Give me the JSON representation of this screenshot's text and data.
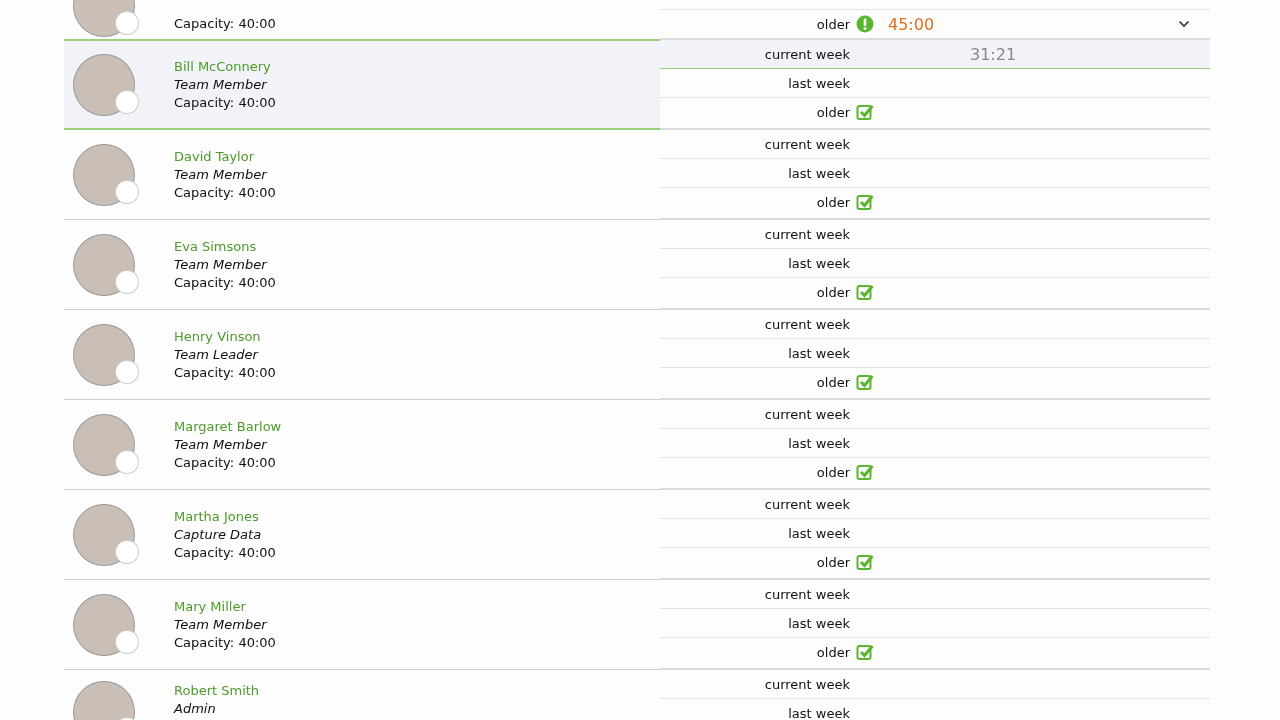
{
  "members": [
    {
      "capacity": "Capacity: 40:00",
      "selected": false,
      "periods": [
        {
          "label": "older",
          "kind": "alert",
          "time": "45:00",
          "color": "#e07020",
          "expandable": true,
          "selected": false
        }
      ]
    },
    {
      "name": "Bill McConnery",
      "role": "Team Member",
      "capacity": "Capacity: 40:00",
      "selected": true,
      "periods": [
        {
          "label": "current week",
          "kind": "plain",
          "time": "31:21",
          "color": "#888888",
          "expandable": false,
          "selected": true
        },
        {
          "label": "last week",
          "kind": "plain",
          "expandable": false,
          "selected": false
        },
        {
          "label": "older",
          "kind": "check",
          "expandable": false,
          "selected": false
        }
      ]
    },
    {
      "name": "David Taylor",
      "role": "Team Member",
      "capacity": "Capacity: 40:00",
      "selected": false,
      "periods": [
        {
          "label": "current week",
          "kind": "plain",
          "expandable": false,
          "selected": false
        },
        {
          "label": "last week",
          "kind": "plain",
          "expandable": false,
          "selected": false
        },
        {
          "label": "older",
          "kind": "check",
          "expandable": false,
          "selected": false
        }
      ]
    },
    {
      "name": "Eva Simsons",
      "role": "Team Member",
      "capacity": "Capacity: 40:00",
      "selected": false,
      "periods": [
        {
          "label": "current week",
          "kind": "plain",
          "expandable": false,
          "selected": false
        },
        {
          "label": "last week",
          "kind": "plain",
          "expandable": false,
          "selected": false
        },
        {
          "label": "older",
          "kind": "check",
          "expandable": false,
          "selected": false
        }
      ]
    },
    {
      "name": "Henry Vinson",
      "role": "Team Leader",
      "capacity": "Capacity: 40:00",
      "selected": false,
      "periods": [
        {
          "label": "current week",
          "kind": "plain",
          "expandable": false,
          "selected": false
        },
        {
          "label": "last week",
          "kind": "plain",
          "expandable": false,
          "selected": false
        },
        {
          "label": "older",
          "kind": "check",
          "expandable": false,
          "selected": false
        }
      ]
    },
    {
      "name": "Margaret Barlow",
      "role": "Team Member",
      "capacity": "Capacity: 40:00",
      "selected": false,
      "periods": [
        {
          "label": "current week",
          "kind": "plain",
          "expandable": false,
          "selected": false
        },
        {
          "label": "last week",
          "kind": "plain",
          "expandable": false,
          "selected": false
        },
        {
          "label": "older",
          "kind": "check",
          "expandable": false,
          "selected": false
        }
      ]
    },
    {
      "name": "Martha Jones",
      "role": "Capture Data",
      "capacity": "Capacity: 40:00",
      "selected": false,
      "periods": [
        {
          "label": "current week",
          "kind": "plain",
          "expandable": false,
          "selected": false
        },
        {
          "label": "last week",
          "kind": "plain",
          "expandable": false,
          "selected": false
        },
        {
          "label": "older",
          "kind": "check",
          "expandable": false,
          "selected": false
        }
      ]
    },
    {
      "name": "Mary Miller",
      "role": "Team Member",
      "capacity": "Capacity: 40:00",
      "selected": false,
      "periods": [
        {
          "label": "current week",
          "kind": "plain",
          "expandable": false,
          "selected": false
        },
        {
          "label": "last week",
          "kind": "plain",
          "expandable": false,
          "selected": false
        },
        {
          "label": "older",
          "kind": "check",
          "expandable": false,
          "selected": false
        }
      ]
    },
    {
      "name": "Robert Smith",
      "role": "Admin",
      "selected": false,
      "periods": [
        {
          "label": "current week",
          "kind": "plain",
          "expandable": false,
          "selected": false
        },
        {
          "label": "last week",
          "kind": "plain",
          "expandable": false,
          "selected": false
        }
      ]
    }
  ]
}
